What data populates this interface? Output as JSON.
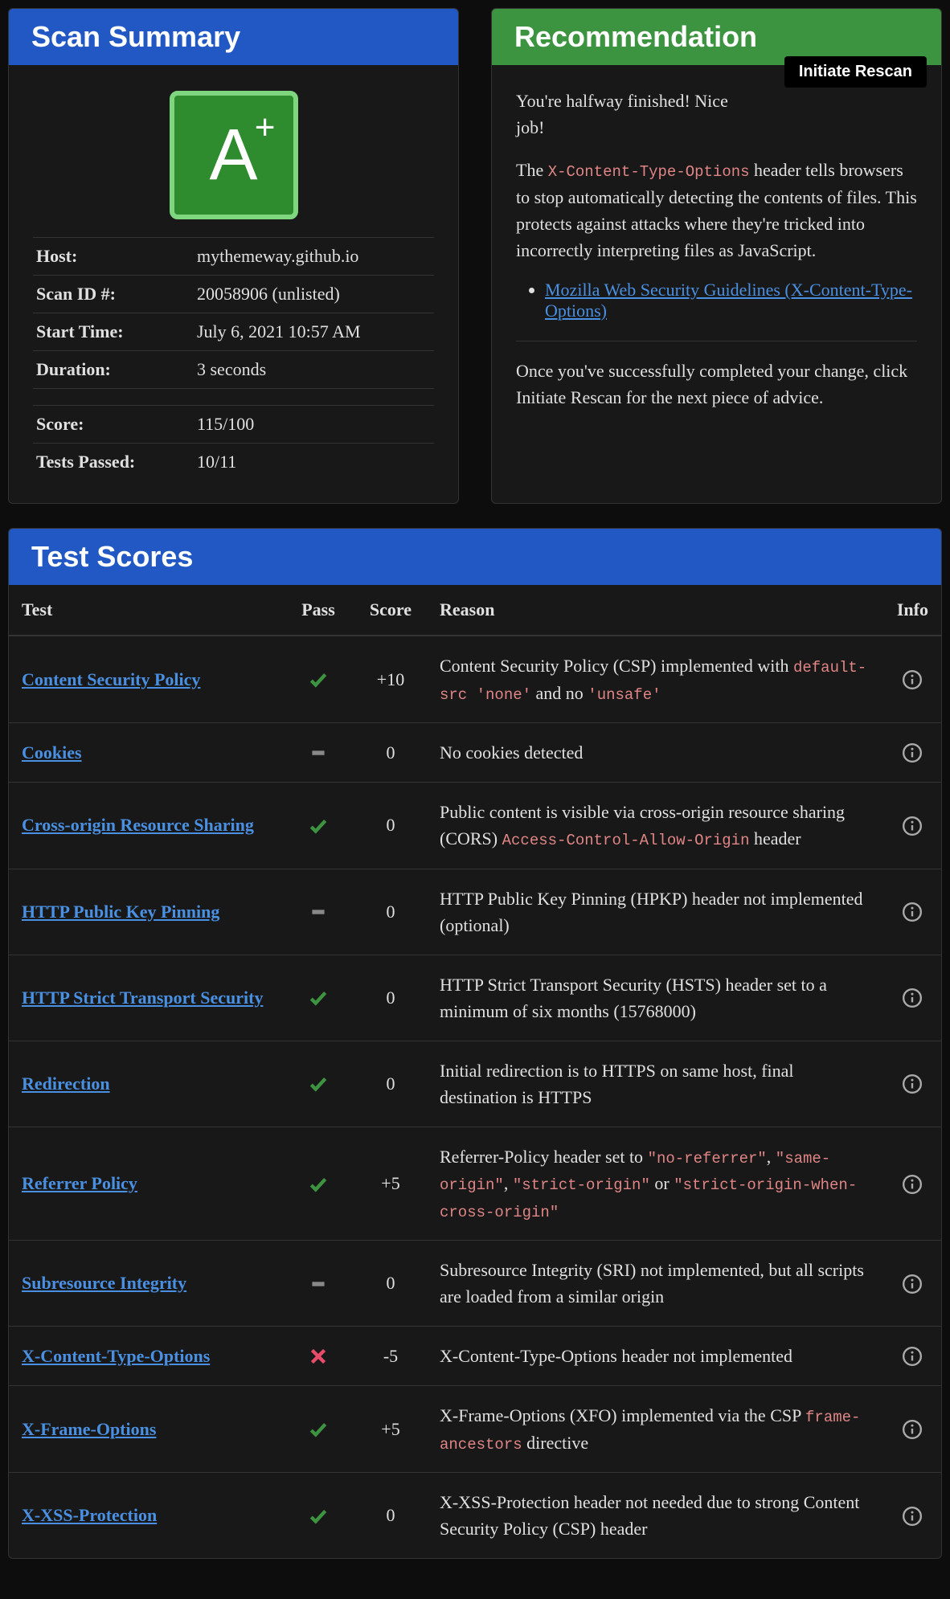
{
  "summary": {
    "title": "Scan Summary",
    "grade_letter": "A",
    "grade_suffix": "+",
    "rows": [
      {
        "label": "Host:",
        "value": "mythemeway.github.io"
      },
      {
        "label": "Scan ID #:",
        "value": "20058906 (unlisted)"
      },
      {
        "label": "Start Time:",
        "value": "July 6, 2021 10:57 AM"
      },
      {
        "label": "Duration:",
        "value": "3 seconds"
      }
    ],
    "rows2": [
      {
        "label": "Score:",
        "value": "115/100"
      },
      {
        "label": "Tests Passed:",
        "value": "10/11"
      }
    ]
  },
  "recommendation": {
    "title": "Recommendation",
    "rescan_label": "Initiate Rescan",
    "intro": "You're halfway finished! Nice job!",
    "para_prefix": "The ",
    "para_code": "X-Content-Type-Options",
    "para_suffix": " header tells browsers to stop automatically detecting the contents of files. This protects against attacks where they're tricked into incorrectly interpreting files as JavaScript.",
    "link_text": "Mozilla Web Security Guidelines (X-Content-Type-Options)",
    "outro": "Once you've successfully completed your change, click Initiate Rescan for the next piece of advice."
  },
  "scores": {
    "title": "Test Scores",
    "headers": {
      "test": "Test",
      "pass": "Pass",
      "score": "Score",
      "reason": "Reason",
      "info": "Info"
    },
    "rows": [
      {
        "name": "Content Security Policy",
        "pass": "check",
        "score": "+10",
        "reason_parts": [
          "Content Security Policy (CSP) implemented with ",
          {
            "code": "default-src 'none'"
          },
          " and no ",
          {
            "code": "'unsafe'"
          }
        ]
      },
      {
        "name": "Cookies",
        "pass": "dash",
        "score": "0",
        "reason_parts": [
          "No cookies detected"
        ]
      },
      {
        "name": "Cross-origin Resource Sharing",
        "pass": "check",
        "score": "0",
        "reason_parts": [
          "Public content is visible via cross-origin resource sharing (CORS) ",
          {
            "code": "Access-Control-Allow-Origin"
          },
          " header"
        ]
      },
      {
        "name": "HTTP Public Key Pinning",
        "pass": "dash",
        "score": "0",
        "reason_parts": [
          "HTTP Public Key Pinning (HPKP) header not implemented (optional)"
        ]
      },
      {
        "name": "HTTP Strict Transport Security",
        "pass": "check",
        "score": "0",
        "reason_parts": [
          "HTTP Strict Transport Security (HSTS) header set to a minimum of six months (15768000)"
        ]
      },
      {
        "name": "Redirection",
        "pass": "check",
        "score": "0",
        "reason_parts": [
          "Initial redirection is to HTTPS on same host, final destination is HTTPS"
        ]
      },
      {
        "name": "Referrer Policy",
        "pass": "check",
        "score": "+5",
        "reason_parts": [
          "Referrer-Policy header set to ",
          {
            "code": "\"no-referrer\""
          },
          ", ",
          {
            "code": "\"same-origin\""
          },
          ", ",
          {
            "code": "\"strict-origin\""
          },
          " or ",
          {
            "code": "\"strict-origin-when-cross-origin\""
          }
        ]
      },
      {
        "name": "Subresource Integrity",
        "pass": "dash",
        "score": "0",
        "reason_parts": [
          "Subresource Integrity (SRI) not implemented, but all scripts are loaded from a similar origin"
        ]
      },
      {
        "name": "X-Content-Type-Options",
        "pass": "cross",
        "score": "-5",
        "reason_parts": [
          "X-Content-Type-Options header not implemented"
        ]
      },
      {
        "name": "X-Frame-Options",
        "pass": "check",
        "score": "+5",
        "reason_parts": [
          "X-Frame-Options (XFO) implemented via the CSP ",
          {
            "code": "frame-ancestors"
          },
          " directive"
        ]
      },
      {
        "name": "X-XSS-Protection",
        "pass": "check",
        "score": "0",
        "reason_parts": [
          "X-XSS-Protection header not needed due to strong Content Security Policy (CSP) header"
        ]
      }
    ]
  }
}
